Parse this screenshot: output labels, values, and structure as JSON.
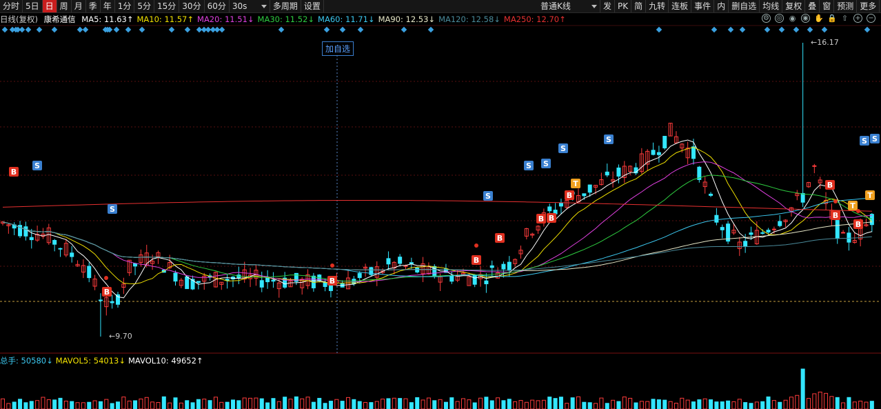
{
  "toolbar": {
    "periods": [
      "分时",
      "5日",
      "日",
      "周",
      "月",
      "季",
      "年",
      "1分",
      "5分",
      "15分",
      "30分",
      "60分",
      "30s",
      "多周期",
      "设置"
    ],
    "active_period": "日",
    "kline_type": "普通K线",
    "right_items": [
      "发",
      "PK",
      "简",
      "九转",
      "连板",
      "事件",
      "内",
      "删自选",
      "均线",
      "复权",
      "叠",
      "窗",
      "预测",
      "更多"
    ]
  },
  "info_bar": {
    "label": "日线(复权)",
    "stock_name": "康希通信",
    "ma": [
      {
        "text": "MA5: 11.63↑",
        "color": "#ffffff"
      },
      {
        "text": "MA10: 11.57↑",
        "color": "#f0e000"
      },
      {
        "text": "MA20: 11.51↓",
        "color": "#e040e0"
      },
      {
        "text": "MA30: 11.52↓",
        "color": "#2ecc40"
      },
      {
        "text": "MA60: 11.71↓",
        "color": "#3cc8f0"
      },
      {
        "text": "MA90: 12.53↓",
        "color": "#e8e8c8"
      },
      {
        "text": "MA120: 12.58↓",
        "color": "#4a8a9a"
      },
      {
        "text": "MA250: 12.70↑",
        "color": "#e83030"
      }
    ]
  },
  "main_chart": {
    "add_favorite_label": "加自选",
    "price_high_label": "16.17",
    "price_low_label": "9.70",
    "price_high": 16.17,
    "price_low": 9.7
  },
  "volume_info": {
    "items": [
      {
        "text": "总手: 50580↓",
        "color": "#3cc8f0"
      },
      {
        "text": "MAVOL5: 54013↓",
        "color": "#f0e000"
      },
      {
        "text": "MAVOL10: 49652↑",
        "color": "#ffffff"
      }
    ]
  },
  "signal_labels": {
    "buy": "B",
    "sell": "S",
    "t": "T"
  },
  "colors": {
    "up": "#ff3c3c",
    "down": "#33e6ff",
    "bg": "#000000",
    "grid": "#5a0f0f"
  }
}
